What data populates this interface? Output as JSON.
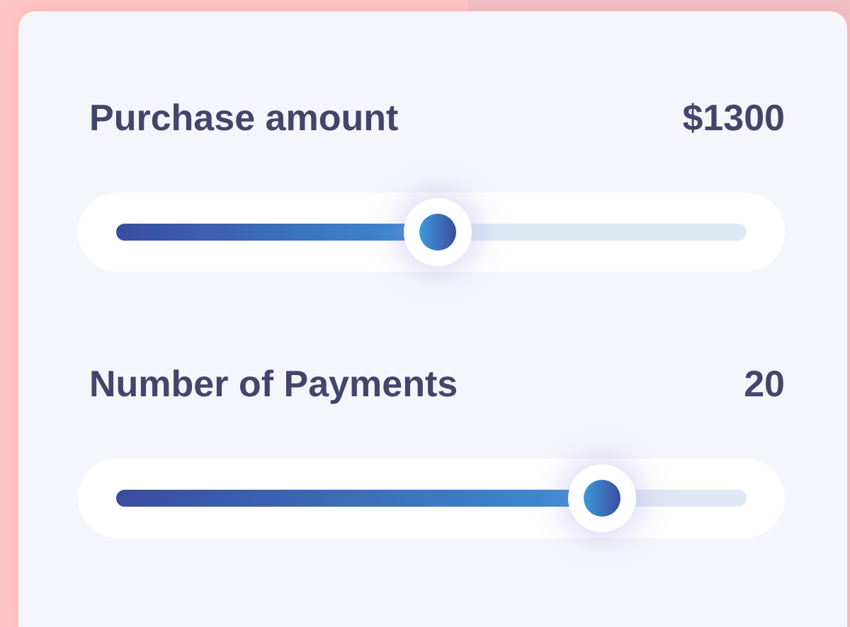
{
  "sliders": [
    {
      "label": "Purchase amount",
      "value": "$1300",
      "level": 0.51
    },
    {
      "label": "Number of Payments",
      "value": "20",
      "level": 0.77
    }
  ]
}
